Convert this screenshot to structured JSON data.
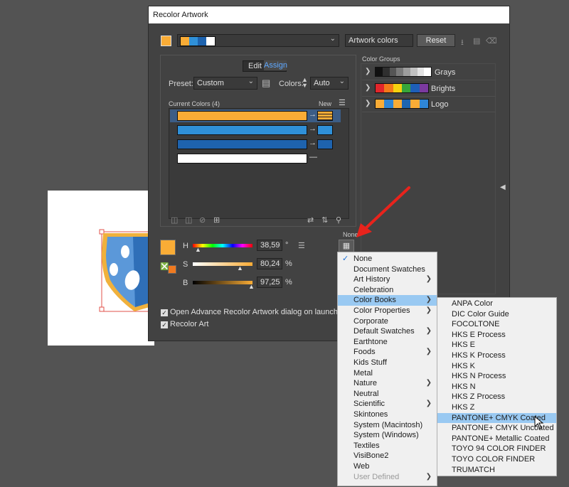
{
  "dialog": {
    "title": "Recolor Artwork",
    "group_name": "Artwork colors",
    "reset_label": "Reset",
    "tabs": [
      "Edit",
      "Assign"
    ],
    "active_tab": "Assign",
    "preset_label": "Preset:",
    "preset_value": "Custom",
    "colors_label": "Colors:",
    "colors_value": "Auto",
    "current_colors_label": "Current Colors (4)",
    "new_label": "New",
    "color_groups_label": "Color Groups",
    "color_groups": [
      {
        "name": "Grays",
        "colors": [
          "#111111",
          "#2f2f2f",
          "#555555",
          "#7a7a7a",
          "#9e9e9e",
          "#c2c2c2",
          "#e3e3e3",
          "#ffffff"
        ]
      },
      {
        "name": "Brights",
        "colors": [
          "#e3262b",
          "#f27a1a",
          "#f5d20f",
          "#37a63a",
          "#1e5fb8",
          "#7b3aa0"
        ]
      },
      {
        "name": "Logo",
        "colors": [
          "#f9ac36",
          "#2f86d6",
          "#f9ac36",
          "#1f65b0",
          "#f9ac36",
          "#2f86d6"
        ]
      }
    ],
    "current_colors": [
      {
        "color": "#f9ac36",
        "new": "#f9ac36",
        "striped": true
      },
      {
        "color": "#2f90d8",
        "new": "#2f90d8",
        "striped": false
      },
      {
        "color": "#1e63ae",
        "new": "#1e63ae",
        "striped": false
      },
      {
        "color": "#ffffff",
        "new": "",
        "striped": false
      }
    ],
    "hsb": {
      "h_label": "H",
      "h_value": "38,59",
      "h_unit": "°",
      "s_label": "S",
      "s_value": "80,24",
      "s_unit": "%",
      "b_label": "B",
      "b_value": "97,25",
      "b_unit": "%"
    },
    "none_label": "None",
    "checkbox_advance": "Open Advance Recolor Artwork dialog on launch",
    "checkbox_recolor": "Recolor Art",
    "selected_color": "#f9ac36"
  },
  "library_menu": {
    "checked": "None",
    "items": [
      {
        "label": "None",
        "submenu": false,
        "checked": true
      },
      {
        "label": "Document Swatches",
        "submenu": false
      },
      {
        "label": "Art History",
        "submenu": true
      },
      {
        "label": "Celebration",
        "submenu": false
      },
      {
        "label": "Color Books",
        "submenu": true,
        "highlighted": true
      },
      {
        "label": "Color Properties",
        "submenu": true
      },
      {
        "label": "Corporate",
        "submenu": false
      },
      {
        "label": "Default Swatches",
        "submenu": true
      },
      {
        "label": "Earthtone",
        "submenu": false
      },
      {
        "label": "Foods",
        "submenu": true
      },
      {
        "label": "Kids Stuff",
        "submenu": false
      },
      {
        "label": "Metal",
        "submenu": false
      },
      {
        "label": "Nature",
        "submenu": true
      },
      {
        "label": "Neutral",
        "submenu": false
      },
      {
        "label": "Scientific",
        "submenu": true
      },
      {
        "label": "Skintones",
        "submenu": false
      },
      {
        "label": "System (Macintosh)",
        "submenu": false
      },
      {
        "label": "System (Windows)",
        "submenu": false
      },
      {
        "label": "Textiles",
        "submenu": false
      },
      {
        "label": "VisiBone2",
        "submenu": false
      },
      {
        "label": "Web",
        "submenu": false
      },
      {
        "label": "User Defined",
        "submenu": true,
        "disabled": true
      }
    ]
  },
  "color_books_menu": {
    "items": [
      {
        "label": "ANPA Color"
      },
      {
        "label": "DIC Color Guide"
      },
      {
        "label": "FOCOLTONE"
      },
      {
        "label": "HKS E Process"
      },
      {
        "label": "HKS E"
      },
      {
        "label": "HKS K Process"
      },
      {
        "label": "HKS K"
      },
      {
        "label": "HKS N Process"
      },
      {
        "label": "HKS N"
      },
      {
        "label": "HKS Z Process"
      },
      {
        "label": "HKS Z"
      },
      {
        "label": "PANTONE+ CMYK Coated",
        "highlighted": true
      },
      {
        "label": "PANTONE+ CMYK Uncoated"
      },
      {
        "label": "PANTONE+ Metallic Coated"
      },
      {
        "label": "TOYO 94 COLOR FINDER"
      },
      {
        "label": "TOYO COLOR FINDER"
      },
      {
        "label": "TRUMATCH"
      }
    ]
  },
  "colors": {
    "accent_arrow": "#e8231c",
    "menu_highlight": "#99c9f2",
    "shield_blue_light": "#5b98d9",
    "shield_blue_dark": "#2f6fb8",
    "shield_border": "#f0b13c"
  }
}
